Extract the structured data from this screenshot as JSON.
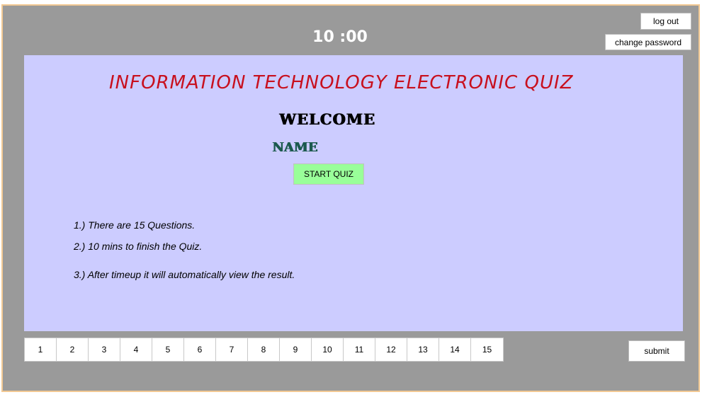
{
  "header": {
    "timer": "10 :00",
    "logout_label": "log out",
    "change_password_label": "change password"
  },
  "main": {
    "title": "INFORMATION TECHNOLOGY ELECTRONIC QUIZ",
    "welcome": "WELCOME",
    "name": "NAME",
    "start_label": "START QUIZ",
    "rules": [
      "1.) There are 15 Questions.",
      "2.) 10 mins to finish the Quiz.",
      "3.) After timeup it will automatically view the result."
    ]
  },
  "question_nav": [
    "1",
    "2",
    "3",
    "4",
    "5",
    "6",
    "7",
    "8",
    "9",
    "10",
    "11",
    "12",
    "13",
    "14",
    "15"
  ],
  "footer": {
    "submit_label": "submit"
  },
  "colors": {
    "frame": "#9a9a9a",
    "panel": "#ccccff",
    "title": "#c8101e",
    "name": "#1c5a4e",
    "start_button": "#99ff99"
  }
}
